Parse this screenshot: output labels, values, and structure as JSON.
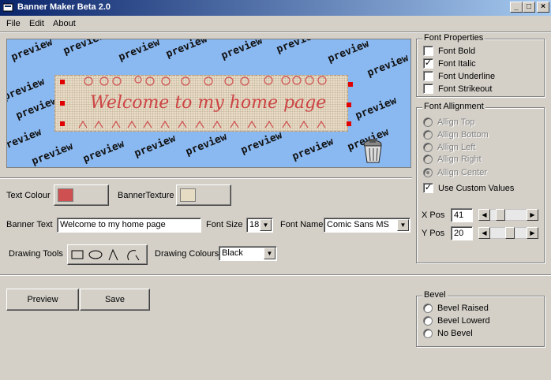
{
  "window": {
    "title": "Banner Maker Beta 2.0",
    "min": "_",
    "max": "□",
    "close": "×"
  },
  "menu": [
    {
      "label": "File"
    },
    {
      "label": "Edit"
    },
    {
      "label": "About"
    }
  ],
  "preview": {
    "watermark": "preview",
    "banner_text": "Welcome to my home page"
  },
  "font_properties": {
    "title": "Font Properties",
    "items": [
      {
        "label": "Font Bold",
        "checked": false
      },
      {
        "label": "Font Italic",
        "checked": true
      },
      {
        "label": "Font Underline",
        "checked": false
      },
      {
        "label": "Font Strikeout",
        "checked": false
      }
    ]
  },
  "font_alignment": {
    "title": "Font Allignment",
    "options": [
      {
        "label": "Allign Top",
        "selected": false
      },
      {
        "label": "Allign Bottom",
        "selected": false
      },
      {
        "label": "Allign Left",
        "selected": false
      },
      {
        "label": "Allign Right",
        "selected": false
      },
      {
        "label": "Allign Center",
        "selected": true
      }
    ],
    "custom": {
      "label": "Use Custom Values",
      "checked": true
    },
    "xpos": {
      "label": "X Pos",
      "value": "41",
      "fraction": 0.2
    },
    "ypos": {
      "label": "Y Pos",
      "value": "20",
      "fraction": 0.55
    }
  },
  "controls": {
    "text_colour_label": "Text Colour",
    "text_colour": "#cf5050",
    "banner_texture_label": "BannerTexture",
    "banner_texture": "#e6dcc4",
    "banner_text_label": "Banner Text",
    "banner_text_value": "Welcome to my home page",
    "font_size_label": "Font Size",
    "font_size_value": "18",
    "font_name_label": "Font Name",
    "font_name_value": "Comic Sans MS",
    "drawing_tools_label": "Drawing Tools",
    "drawing_colours_label": "Drawing Colours",
    "drawing_colours_value": "Black"
  },
  "buttons": {
    "preview": "Preview",
    "save": "Save"
  },
  "bevel": {
    "title": "Bevel",
    "options": [
      {
        "label": "Bevel Raised"
      },
      {
        "label": "Bevel Lowerd"
      },
      {
        "label": "No Bevel"
      }
    ]
  }
}
